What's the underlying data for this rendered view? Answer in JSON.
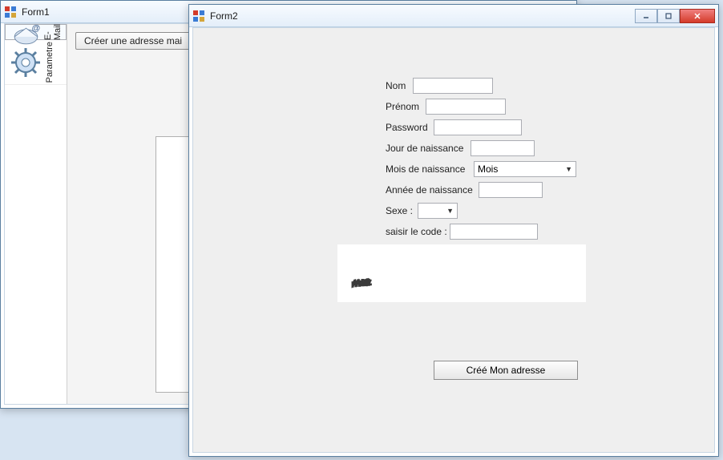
{
  "form1": {
    "title": "Form1",
    "sidebar": {
      "items": [
        {
          "label": "E-Mail",
          "icon": "mail-icon"
        },
        {
          "label": "Parametre",
          "icon": "gear-icon"
        }
      ]
    },
    "create_button_label": "Créer une adresse mai"
  },
  "form2": {
    "title": "Form2",
    "fields": {
      "nom_label": "Nom",
      "prenom_label": "Prénom",
      "password_label": "Password",
      "jour_label": "Jour de naissance",
      "mois_label": "Mois de naissance",
      "mois_selected": "Mois",
      "annee_label": "Année de naissance",
      "sexe_label": "Sexe :",
      "sexe_selected": "",
      "code_label": "saisir le code :"
    },
    "captcha_text": "rAAn5d8z",
    "submit_label": "Créé Mon adresse"
  },
  "colors": {
    "window_border": "#5a7fa0",
    "close_red": "#d43b2a"
  }
}
